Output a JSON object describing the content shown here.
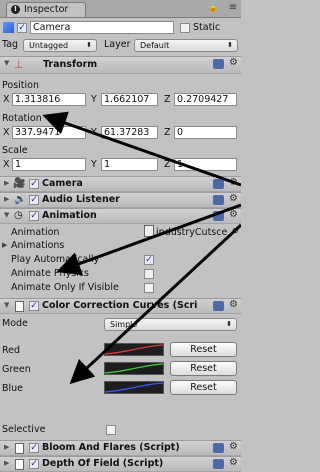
{
  "tab": {
    "label": "Inspector",
    "icon": "info-icon"
  },
  "object": {
    "name": "Camera",
    "static_label": "Static",
    "tag_label": "Tag",
    "tag_value": "Untagged",
    "layer_label": "Layer",
    "layer_value": "Default"
  },
  "transform": {
    "title": "Transform",
    "position_label": "Position",
    "position": {
      "x": "1.313816",
      "y": "1.662107",
      "z": "0.2709427"
    },
    "rotation_label": "Rotation",
    "rotation": {
      "x": "337.9471",
      "y": "61.37283",
      "z": "0"
    },
    "scale_label": "Scale",
    "scale": {
      "x": "1",
      "y": "1",
      "z": "1"
    },
    "axis_x": "X",
    "axis_y": "Y",
    "axis_z": "Z"
  },
  "components": {
    "camera": "Camera",
    "audio_listener": "Audio Listener",
    "animation": "Animation"
  },
  "animation": {
    "animation_label": "Animation",
    "animation_value": "industryCutsce",
    "animations_label": "Animations",
    "play_auto_label": "Play Automatically",
    "animate_physics_label": "Animate Physics",
    "animate_visible_label": "Animate Only If Visible"
  },
  "ccc": {
    "title": "Color Correction Curves (Scri",
    "mode_label": "Mode",
    "mode_value": "Simple",
    "red_label": "Red",
    "green_label": "Green",
    "blue_label": "Blue",
    "reset_label": "Reset",
    "selective_label": "Selective"
  },
  "bloom": {
    "title": "Bloom And Flares (Script)"
  },
  "dof": {
    "title": "Depth Of Field (Script)"
  },
  "colors": {
    "red_curve": "#e03a3a",
    "green_curve": "#3ad03a",
    "blue_curve": "#3a5aff"
  }
}
